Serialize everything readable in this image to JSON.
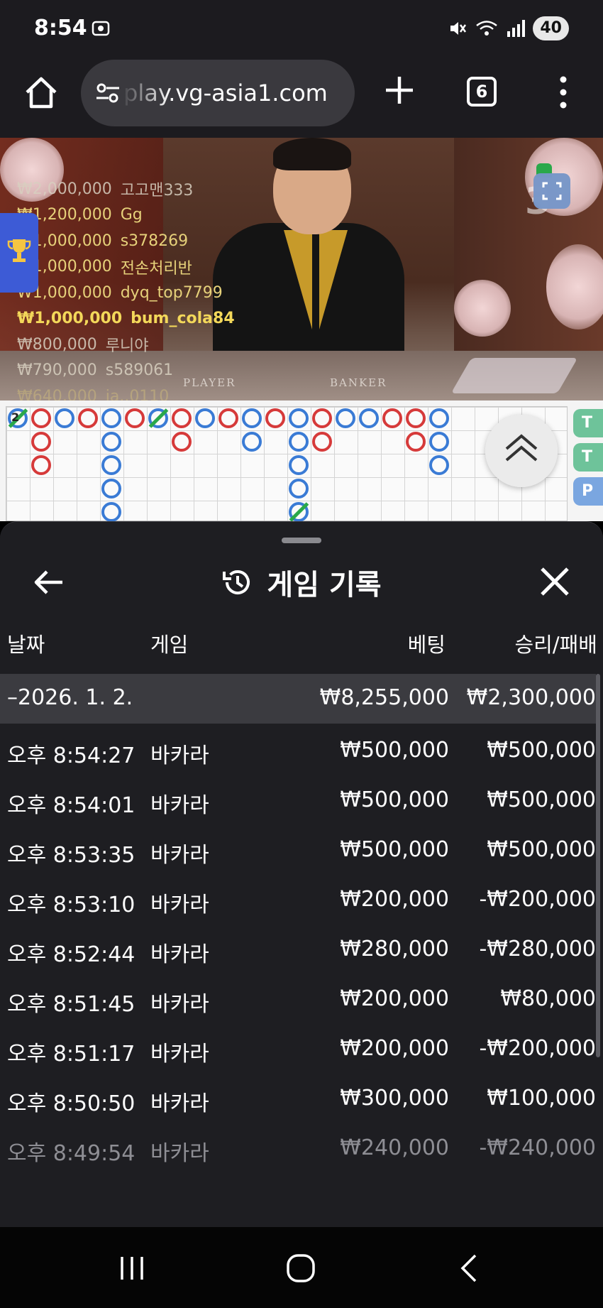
{
  "status_bar": {
    "time": "8:54",
    "battery": "40",
    "icons": [
      "screen-recorder-icon",
      "mute-icon",
      "wifi-icon",
      "signal-icon"
    ]
  },
  "browser": {
    "url": "play.vg-asia1.com",
    "tab_count": "6",
    "icons": [
      "home-icon",
      "site-settings-icon",
      "new-tab-plus-icon",
      "tab-switcher-icon",
      "more-menu-icon"
    ]
  },
  "video": {
    "round_number": "3",
    "table_labels": {
      "player": "PLAYER",
      "banker": "BANKER"
    },
    "leaderboard": [
      {
        "amount": "₩2,000,000",
        "name": "고고맨333",
        "style": "dim"
      },
      {
        "amount": "₩1,200,000",
        "name": "Gg",
        "style": "normal"
      },
      {
        "amount": "₩1,000,000",
        "name": "s378269",
        "style": "normal"
      },
      {
        "amount": "₩1,000,000",
        "name": "전손처리반",
        "style": "normal"
      },
      {
        "amount": "₩1,000,000",
        "name": "dyq_top7799",
        "style": "normal"
      },
      {
        "amount": "₩1,000,000",
        "name": "bum_cola84",
        "style": "bright"
      },
      {
        "amount": "₩800,000",
        "name": "루니야",
        "style": "dim"
      },
      {
        "amount": "₩790,000",
        "name": "s589061",
        "style": "dim"
      },
      {
        "amount": "₩640,000",
        "name": "ja..0110",
        "style": "faint"
      }
    ]
  },
  "road_map": {
    "label": "2",
    "side_tabs": [
      "T",
      "T",
      "P"
    ],
    "colors": {
      "banker": "#d63a3a",
      "player": "#3a7bd5",
      "tie": "#2aa84a"
    }
  },
  "history": {
    "title": "게임 기록",
    "columns": {
      "date": "날짜",
      "game": "게임",
      "bet": "베팅",
      "result": "승리/패배"
    },
    "date_group": {
      "label": "–2026. 1. 2.",
      "total_bet": "₩8,255,000",
      "total_result": "₩2,300,000"
    },
    "rows": [
      {
        "time": "오후 8:54:27",
        "game": "바카라",
        "bet": "₩500,000",
        "result": "₩500,000"
      },
      {
        "time": "오후 8:54:01",
        "game": "바카라",
        "bet": "₩500,000",
        "result": "₩500,000"
      },
      {
        "time": "오후 8:53:35",
        "game": "바카라",
        "bet": "₩500,000",
        "result": "₩500,000"
      },
      {
        "time": "오후 8:53:10",
        "game": "바카라",
        "bet": "₩200,000",
        "result": "-₩200,000"
      },
      {
        "time": "오후 8:52:44",
        "game": "바카라",
        "bet": "₩280,000",
        "result": "-₩280,000"
      },
      {
        "time": "오후 8:51:45",
        "game": "바카라",
        "bet": "₩200,000",
        "result": "₩80,000"
      },
      {
        "time": "오후 8:51:17",
        "game": "바카라",
        "bet": "₩200,000",
        "result": "-₩200,000"
      },
      {
        "time": "오후 8:50:50",
        "game": "바카라",
        "bet": "₩300,000",
        "result": "₩100,000"
      },
      {
        "time": "오후 8:49:54",
        "game": "바카라",
        "bet": "₩240,000",
        "result": "-₩240,000"
      }
    ]
  },
  "nav_bar": {
    "icons": [
      "recent-apps-icon",
      "home-circle-icon",
      "back-chevron-icon"
    ]
  }
}
